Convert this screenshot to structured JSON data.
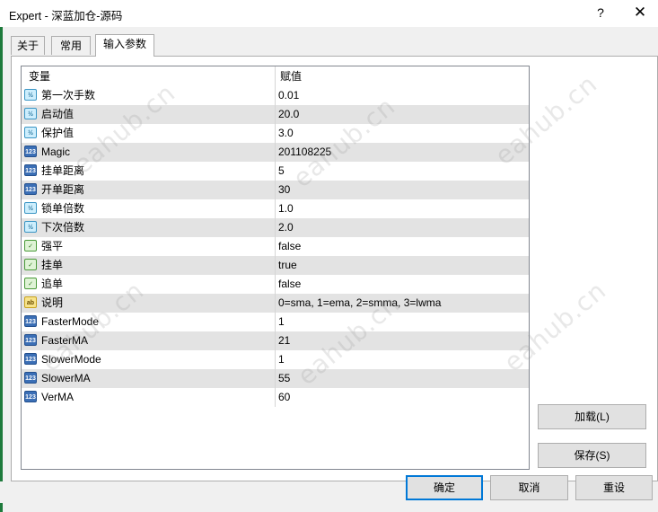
{
  "window": {
    "title": "Expert - 深蓝加仓-源码",
    "help_glyph": "?",
    "close_glyph": "✕",
    "accent_color": "#1e7a3c"
  },
  "tabs": [
    {
      "label": "关于"
    },
    {
      "label": "常用"
    },
    {
      "label": "输入参数"
    }
  ],
  "grid": {
    "col_variable": "变量",
    "col_value": "赋值",
    "rows": [
      {
        "icon": "double",
        "icon_glyph": "½",
        "name": "第一次手数",
        "value": "0.01"
      },
      {
        "icon": "double",
        "icon_glyph": "½",
        "name": "启动值",
        "value": "20.0"
      },
      {
        "icon": "double",
        "icon_glyph": "½",
        "name": "保护值",
        "value": "3.0"
      },
      {
        "icon": "int",
        "icon_glyph": "123",
        "name": "Magic",
        "value": "201108225"
      },
      {
        "icon": "int",
        "icon_glyph": "123",
        "name": "挂单距离",
        "value": "5"
      },
      {
        "icon": "int",
        "icon_glyph": "123",
        "name": "开单距离",
        "value": "30"
      },
      {
        "icon": "double",
        "icon_glyph": "½",
        "name": "锁单倍数",
        "value": "1.0"
      },
      {
        "icon": "double",
        "icon_glyph": "½",
        "name": "下次倍数",
        "value": "2.0"
      },
      {
        "icon": "bool",
        "icon_glyph": "✓",
        "name": "强平",
        "value": "false"
      },
      {
        "icon": "bool",
        "icon_glyph": "✓",
        "name": "挂单",
        "value": "true"
      },
      {
        "icon": "bool",
        "icon_glyph": "✓",
        "name": "追单",
        "value": "false"
      },
      {
        "icon": "string",
        "icon_glyph": "ab",
        "name": "说明",
        "value": "0=sma, 1=ema, 2=smma, 3=lwma"
      },
      {
        "icon": "int",
        "icon_glyph": "123",
        "name": "FasterMode",
        "value": "1"
      },
      {
        "icon": "int",
        "icon_glyph": "123",
        "name": "FasterMA",
        "value": "21"
      },
      {
        "icon": "int",
        "icon_glyph": "123",
        "name": "SlowerMode",
        "value": "1"
      },
      {
        "icon": "int",
        "icon_glyph": "123",
        "name": "SlowerMA",
        "value": "55"
      },
      {
        "icon": "int",
        "icon_glyph": "123",
        "name": "VerMA",
        "value": "60"
      }
    ]
  },
  "side_buttons": {
    "load": "加载(L)",
    "save": "保存(S)"
  },
  "footer_buttons": {
    "ok": "确定",
    "cancel": "取消",
    "reset": "重设"
  },
  "watermark": "eahub.cn"
}
